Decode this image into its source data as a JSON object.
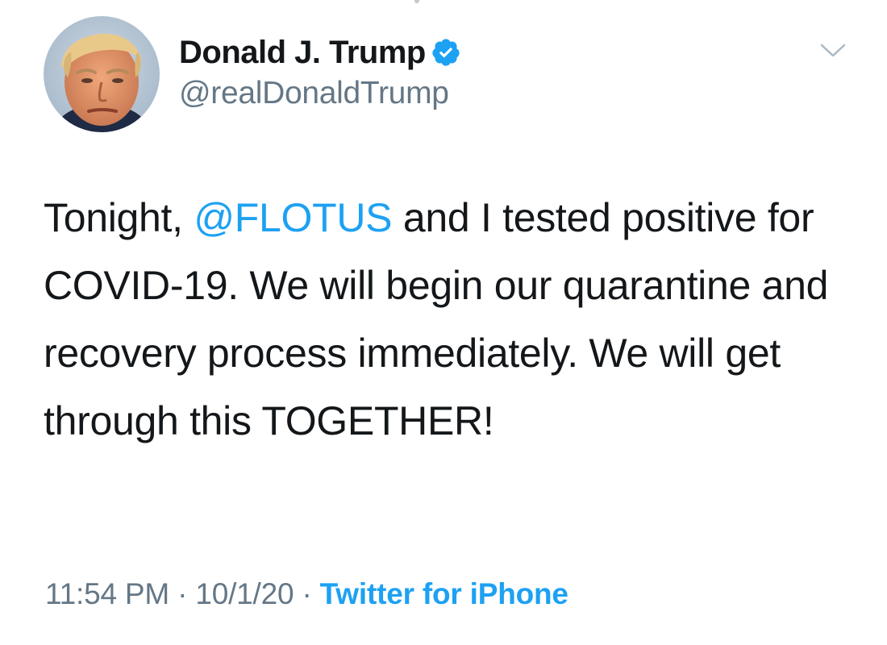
{
  "tweet": {
    "author": {
      "display_name": "Donald J. Trump",
      "handle": "@realDonaldTrump",
      "verified_icon": "verified-badge-icon",
      "avatar": "profile-photo"
    },
    "menu_icon": "chevron-down-icon",
    "text": {
      "part1": "Tonight, ",
      "mention": "@FLOTUS",
      "part2": " and I tested positive for COVID-19. We will begin our quarantine and recovery process immediately. We will get through this TOGETHER!"
    },
    "meta": {
      "time": "11:54 PM",
      "separator": " · ",
      "date": "10/1/20",
      "source": "Twitter for iPhone"
    }
  },
  "colors": {
    "link": "#1da1f2",
    "secondary_text": "#657786",
    "primary_text": "#14171a",
    "background": "#ffffff"
  }
}
